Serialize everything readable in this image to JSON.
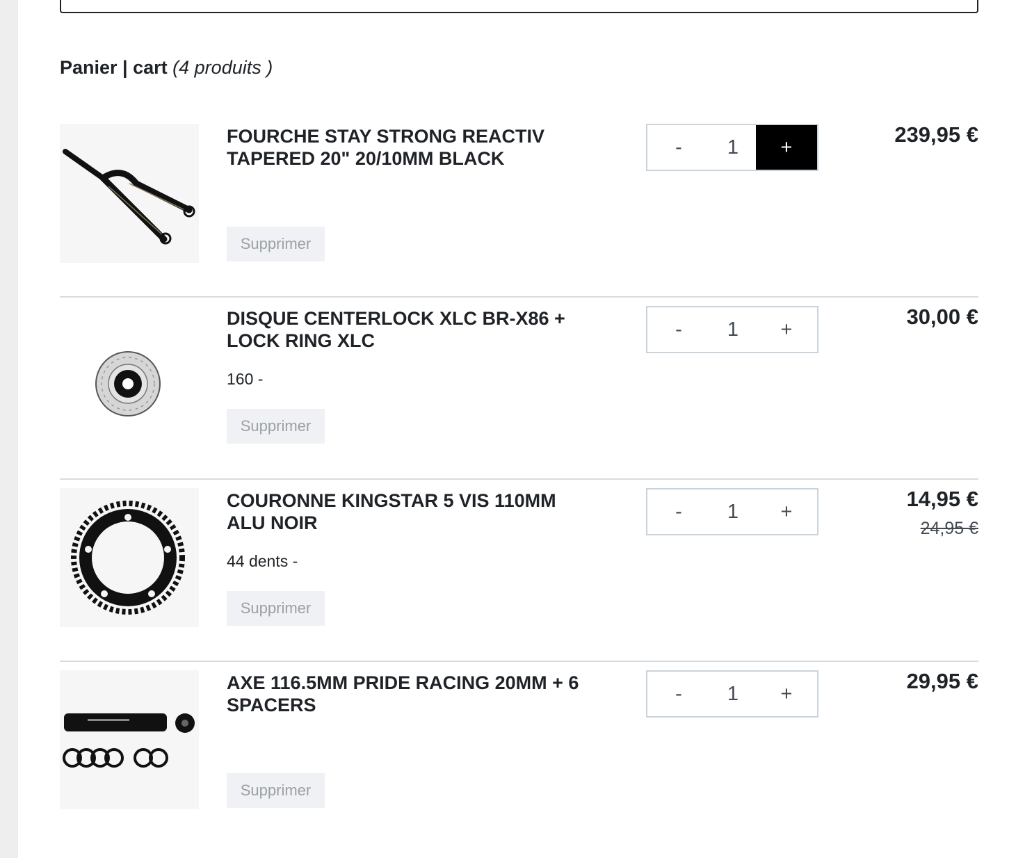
{
  "cart": {
    "title": "Panier | cart",
    "count_text": "(4 produits )",
    "remove_label": "Supprimer",
    "minus_label": "-",
    "plus_label": "+",
    "items": [
      {
        "name": "FOURCHE STAY STRONG REACTIV TAPERED 20\" 20/10MM BLACK",
        "variant": "",
        "quantity": "1",
        "price": "239,95 €",
        "old_price": "",
        "image": "fork-image"
      },
      {
        "name": "DISQUE CENTERLOCK XLC BR-X86 + LOCK RING XLC",
        "variant": "160 -",
        "quantity": "1",
        "price": "30,00 €",
        "old_price": "",
        "image": "brake-disc-image"
      },
      {
        "name": "COURONNE KINGSTAR 5 VIS 110MM ALU NOIR",
        "variant": "44 dents -",
        "quantity": "1",
        "price": "14,95 €",
        "old_price": "24,95 €",
        "image": "chainring-image"
      },
      {
        "name": "AXE 116.5MM PRIDE RACING 20MM + 6 SPACERS",
        "variant": "",
        "quantity": "1",
        "price": "29,95 €",
        "old_price": "",
        "image": "axle-image"
      }
    ]
  },
  "colors": {
    "text": "#1f2328",
    "plus_active_bg": "#000000",
    "remove_bg": "#f0f1f4",
    "border": "#c9d3dc"
  }
}
